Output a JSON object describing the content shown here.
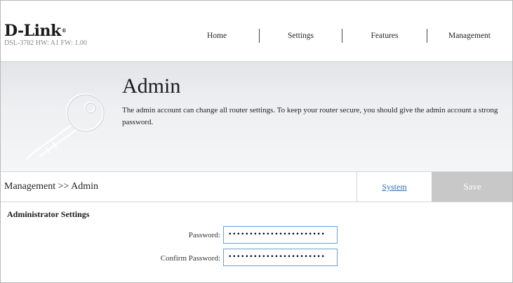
{
  "brand": {
    "logo_text": "D-Link",
    "hw_info": "DSL-3782  HW: A1  FW: 1.00"
  },
  "nav": {
    "items": [
      {
        "label": "Home"
      },
      {
        "label": "Settings"
      },
      {
        "label": "Features"
      },
      {
        "label": "Management"
      }
    ]
  },
  "banner": {
    "title": "Admin",
    "description": "The admin account can change all router settings. To keep your router secure, you should give the admin account a strong password.",
    "icon": "key-icon"
  },
  "toolbar": {
    "breadcrumb": "Management >> Admin",
    "system_link": "System",
    "save_label": "Save"
  },
  "form": {
    "section_title": "Administrator Settings",
    "password_label": "Password:",
    "password_value": "•••••••••••••••••••••••",
    "confirm_label": "Confirm Password:",
    "confirm_value": "•••••••••••••••••••••••"
  },
  "colors": {
    "link": "#2b6fb3",
    "save_disabled": "#c8c8c8",
    "input_border": "#6fa0c8"
  }
}
